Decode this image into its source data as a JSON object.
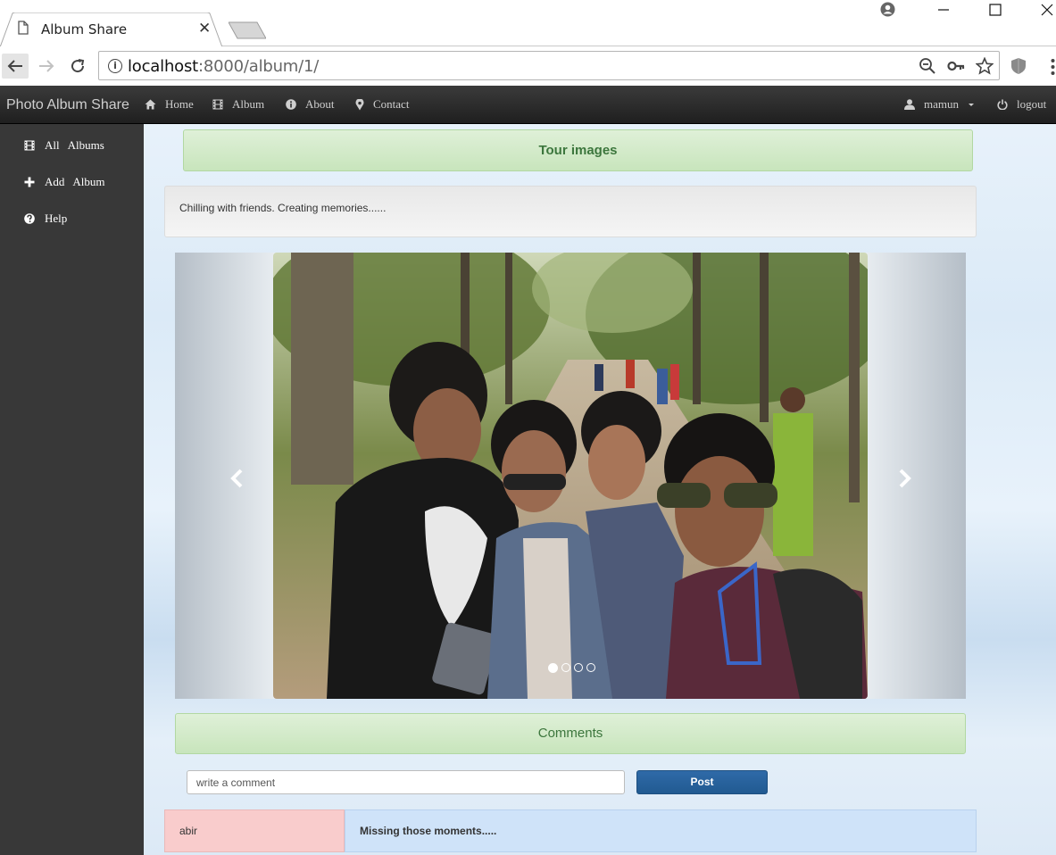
{
  "browser": {
    "tab_title": "Album Share",
    "url_host": "localhost",
    "url_path": ":8000/album/1/"
  },
  "navbar": {
    "brand": "Photo Album Share",
    "items": [
      {
        "label": "Home",
        "icon": "home-icon"
      },
      {
        "label": "Album",
        "icon": "film-icon"
      },
      {
        "label": "About",
        "icon": "info-circle-icon"
      },
      {
        "label": "Contact",
        "icon": "map-marker-icon"
      }
    ],
    "user": "mamun",
    "logout": "logout"
  },
  "sidebar": {
    "items": [
      {
        "label": "All   Albums",
        "icon": "film-icon"
      },
      {
        "label": "Add   Album",
        "icon": "plus-icon"
      },
      {
        "label": "Help",
        "icon": "question-circle-icon"
      }
    ]
  },
  "album": {
    "title": "Tour images",
    "description": "Chilling with friends. Creating memories......"
  },
  "carousel": {
    "slide_count": 4,
    "active_index": 0
  },
  "comments": {
    "heading": "Comments",
    "input_placeholder": "write a comment",
    "post_label": "Post",
    "list": [
      {
        "user": "abir",
        "text": "Missing those moments....."
      }
    ]
  },
  "colors": {
    "navbar": "#2b2b2b",
    "sidebar": "#383838",
    "success_panel": "#dff0d8",
    "primary_button": "#286090",
    "comment_user_bg": "#f9cccc",
    "comment_text_bg": "#cfe3f9"
  }
}
